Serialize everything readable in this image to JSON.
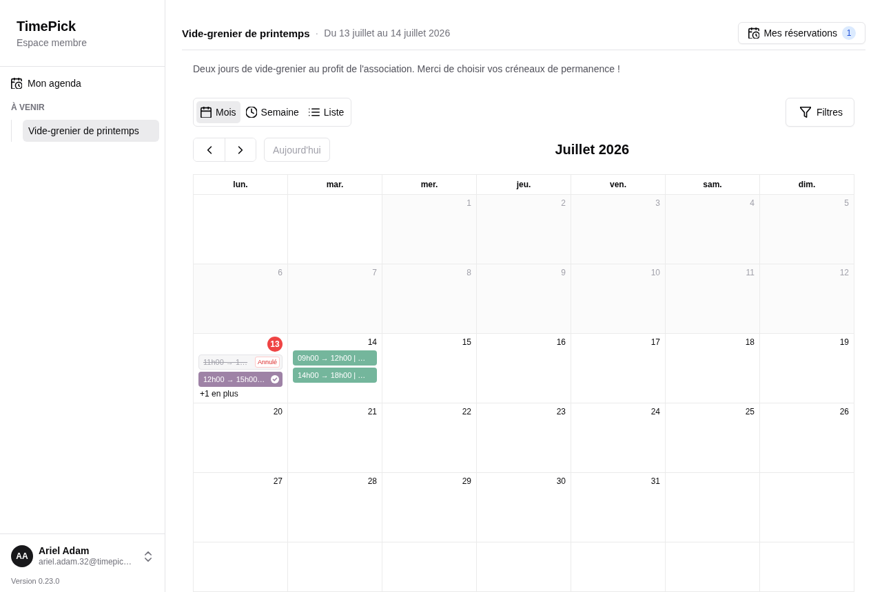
{
  "sidebar": {
    "brand": "TimePick",
    "subtitle": "Espace membre",
    "nav": [
      {
        "label": "Mon agenda",
        "selected": false
      }
    ],
    "section_label": "À VENIR",
    "upcoming": [
      {
        "label": "Vide-grenier de printemps",
        "selected": true
      }
    ],
    "user": {
      "initials": "AA",
      "name": "Ariel Adam",
      "email": "ariel.adam.32@timepic…"
    },
    "version": "Version 0.23.0"
  },
  "header": {
    "title": "Vide-grenier de printemps",
    "separator": "·",
    "dates": "Du 13 juillet au 14 juillet 2026",
    "reservations_button": {
      "label": "Mes réservations",
      "count": "1"
    }
  },
  "description": "Deux jours de vide-grenier au profit de l'association. Merci de choisir vos créneaux de permanence !",
  "views": [
    {
      "kind": "month",
      "label": "Mois",
      "selected": true
    },
    {
      "kind": "week",
      "label": "Semaine",
      "selected": false
    },
    {
      "kind": "list",
      "label": "Liste",
      "selected": false
    }
  ],
  "filters_button": "Filtres",
  "today_button": {
    "label": "Aujourd'hui",
    "disabled": true
  },
  "month_title": "Juillet 2026",
  "weekdays": [
    "lun.",
    "mar.",
    "mer.",
    "jeu.",
    "ven.",
    "sam.",
    "dim."
  ],
  "weeks": [
    [
      {
        "kind": "blank"
      },
      {
        "kind": "blank"
      },
      {
        "kind": "past",
        "day": "1"
      },
      {
        "kind": "past",
        "day": "2"
      },
      {
        "kind": "past",
        "day": "3"
      },
      {
        "kind": "past",
        "day": "4"
      },
      {
        "kind": "past",
        "day": "5"
      }
    ],
    [
      {
        "kind": "past",
        "day": "6"
      },
      {
        "kind": "past",
        "day": "7"
      },
      {
        "kind": "past",
        "day": "8"
      },
      {
        "kind": "past",
        "day": "9"
      },
      {
        "kind": "past",
        "day": "10"
      },
      {
        "kind": "past",
        "day": "11"
      },
      {
        "kind": "past",
        "day": "12"
      }
    ],
    [
      {
        "kind": "today",
        "day": "13",
        "events": [
          {
            "kind": "cancelled",
            "label": "11h00 → 1…",
            "badge": "Annulé"
          },
          {
            "kind": "confirmed",
            "label": "12h00 → 15h00…",
            "color": "#9e82a6"
          }
        ],
        "more": "+1 en plus"
      },
      {
        "kind": "upcoming",
        "day": "14",
        "events": [
          {
            "kind": "open",
            "label": "09h00 → 12h00 | …",
            "color": "#74b69c"
          },
          {
            "kind": "open",
            "label": "14h00 → 18h00 | …",
            "color": "#74b69c"
          }
        ]
      },
      {
        "kind": "upcoming",
        "day": "15"
      },
      {
        "kind": "upcoming",
        "day": "16"
      },
      {
        "kind": "upcoming",
        "day": "17"
      },
      {
        "kind": "upcoming",
        "day": "18"
      },
      {
        "kind": "upcoming",
        "day": "19"
      }
    ],
    [
      {
        "kind": "upcoming",
        "day": "20"
      },
      {
        "kind": "upcoming",
        "day": "21"
      },
      {
        "kind": "upcoming",
        "day": "22"
      },
      {
        "kind": "upcoming",
        "day": "23"
      },
      {
        "kind": "upcoming",
        "day": "24"
      },
      {
        "kind": "upcoming",
        "day": "25"
      },
      {
        "kind": "upcoming",
        "day": "26"
      }
    ],
    [
      {
        "kind": "upcoming",
        "day": "27"
      },
      {
        "kind": "upcoming",
        "day": "28"
      },
      {
        "kind": "upcoming",
        "day": "29"
      },
      {
        "kind": "upcoming",
        "day": "30"
      },
      {
        "kind": "upcoming",
        "day": "31"
      },
      {
        "kind": "blank"
      },
      {
        "kind": "blank"
      }
    ],
    [
      {
        "kind": "blank"
      },
      {
        "kind": "blank"
      },
      {
        "kind": "blank"
      },
      {
        "kind": "blank"
      },
      {
        "kind": "blank"
      },
      {
        "kind": "blank"
      },
      {
        "kind": "blank"
      }
    ]
  ]
}
